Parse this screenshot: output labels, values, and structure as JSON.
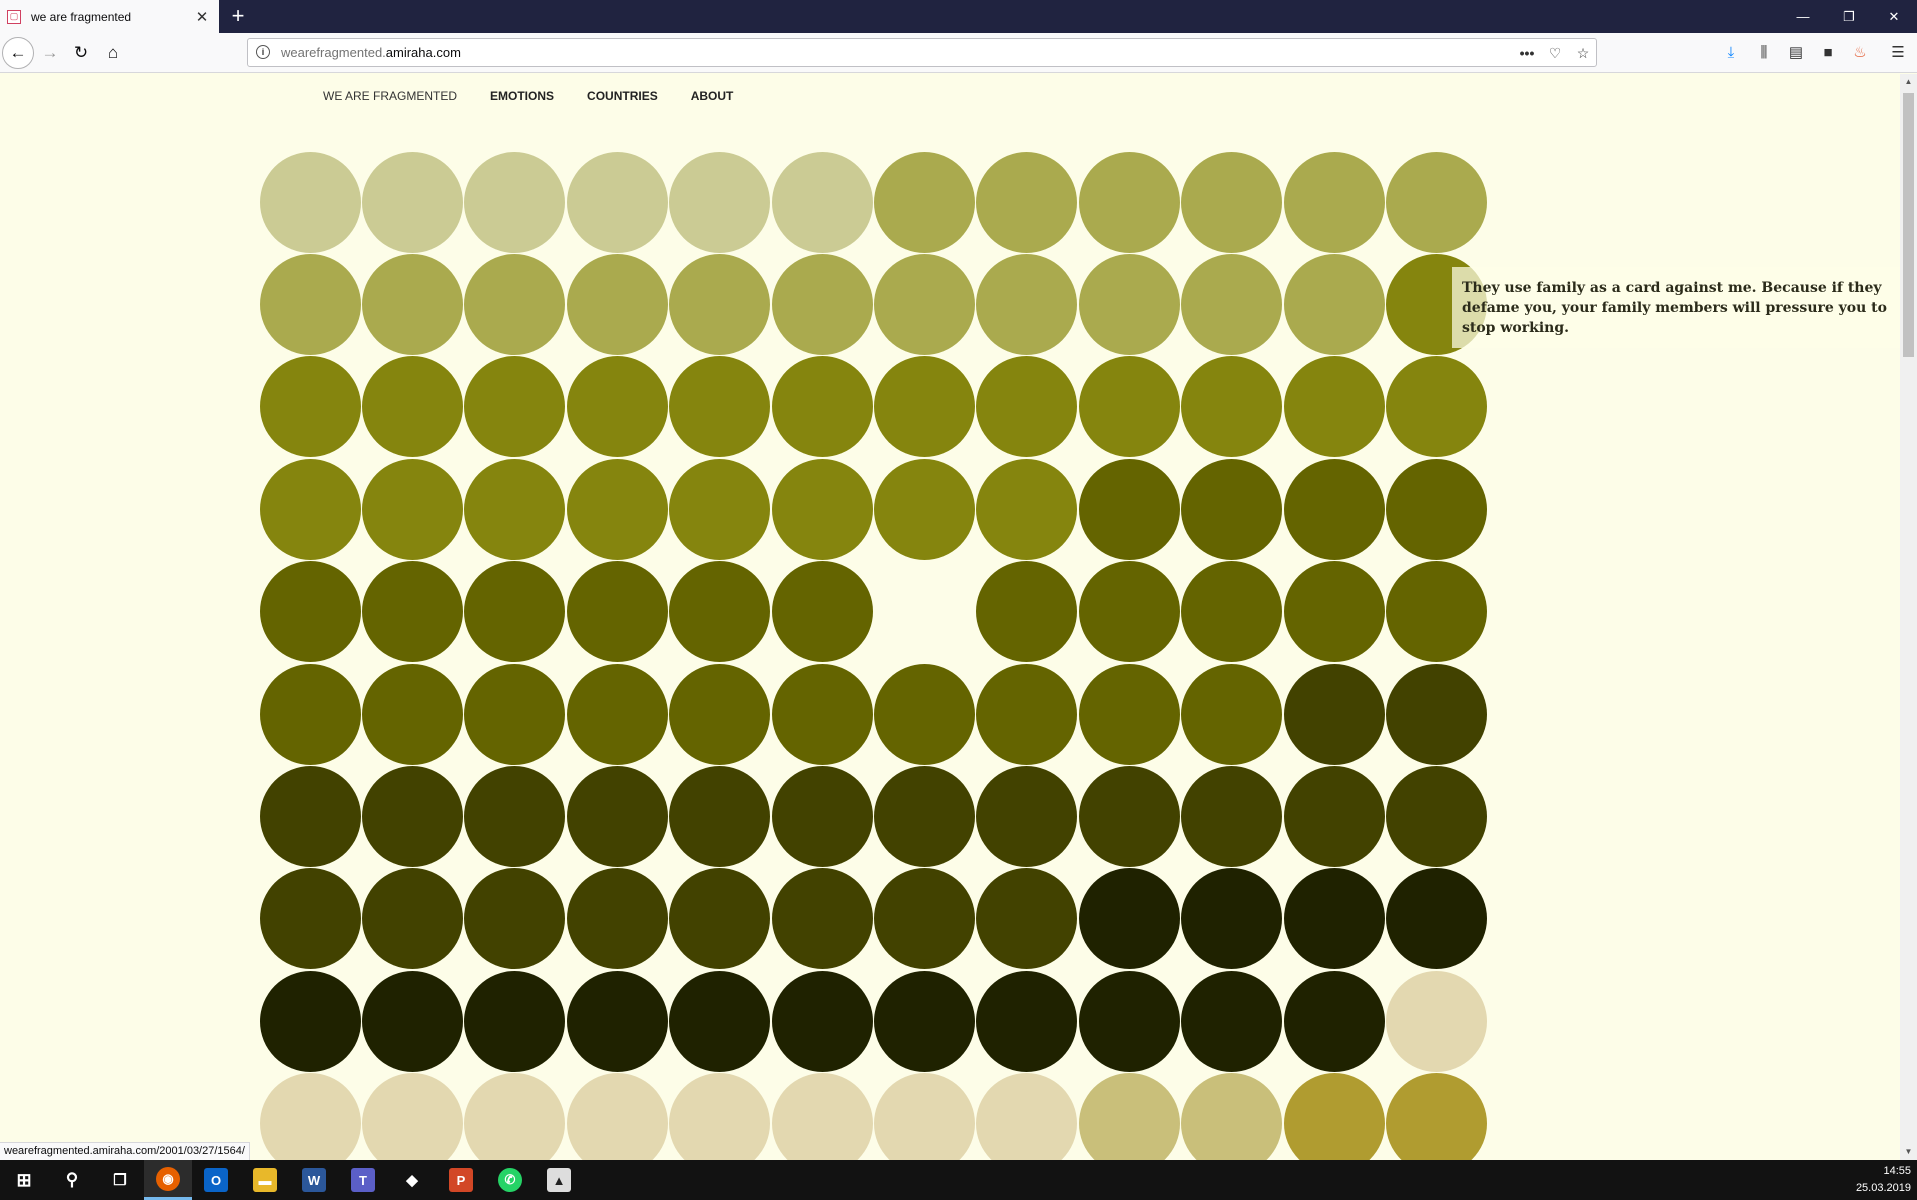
{
  "browser": {
    "tab_title": "we are fragmented",
    "tab_favicon": "page-icon",
    "url_host_prefix": "wearefragmented.",
    "url_host": "amiraha.com",
    "status_url": "wearefragmented.amiraha.com/2001/03/27/1564/"
  },
  "site_nav": {
    "brand": "WE ARE FRAGMENTED",
    "links": [
      "EMOTIONS",
      "COUNTRIES",
      "ABOUT"
    ]
  },
  "quote": "They use family as a card against me. Because if they defame you, your family members will pressure you to stop working.",
  "palette": {
    "a": "#cbcb94",
    "b": "#aaaa4e",
    "c": "#85850e",
    "d": "#646400",
    "e": "#424200",
    "f": "#1f2200",
    "g": "#e3d8b0",
    "h": "#c9bf7a",
    "i": "#b09c30"
  },
  "grid_rows": [
    "aaaaaabbbbbb",
    "bbbbbbbbbbbc",
    "cccccccccccc",
    "ccccccccdddd",
    "dddddd.ddddd",
    "ddddddddddee",
    "eeeeeeeeeeee",
    "eeeeeeeeffff",
    "fffffffffffg",
    "gggggggghhii"
  ],
  "taskbar": {
    "time": "14:55",
    "date": "25.03.2019",
    "items": [
      "start-icon",
      "search-icon",
      "task-view-icon",
      "firefox-icon",
      "outlook-icon",
      "file-explorer-icon",
      "word-icon",
      "teams-icon",
      "app-icon",
      "powerpoint-icon",
      "whatsapp-icon",
      "photos-icon"
    ]
  }
}
